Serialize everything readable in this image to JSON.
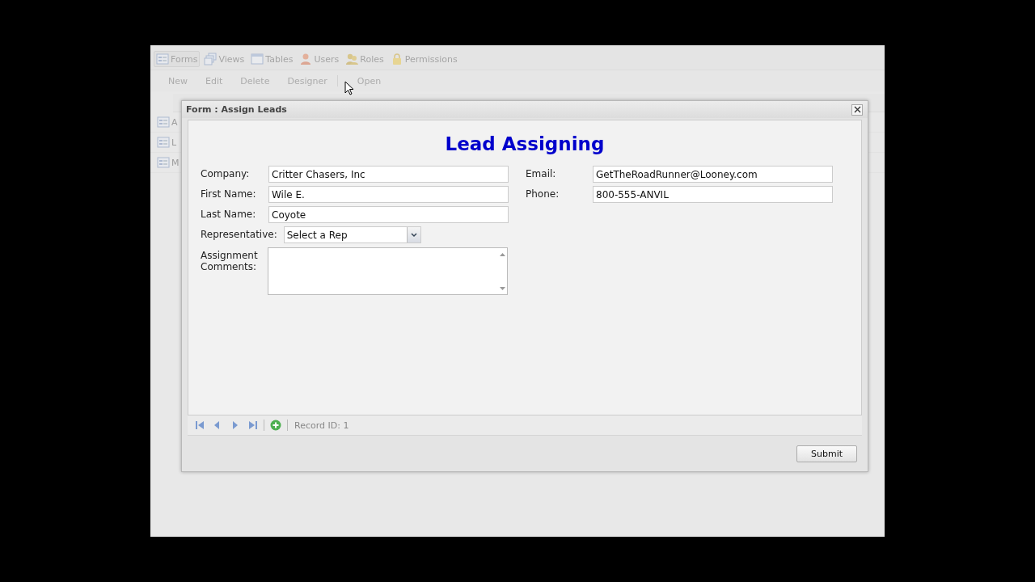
{
  "nav_tabs": [
    {
      "label": "Forms",
      "selected": true
    },
    {
      "label": "Views",
      "selected": false
    },
    {
      "label": "Tables",
      "selected": false
    },
    {
      "label": "Users",
      "selected": false
    },
    {
      "label": "Roles",
      "selected": false
    },
    {
      "label": "Permissions",
      "selected": false
    }
  ],
  "toolbar": [
    {
      "label": "New"
    },
    {
      "label": "Edit"
    },
    {
      "label": "Delete"
    },
    {
      "label": "Designer"
    },
    {
      "label": "Open"
    }
  ],
  "grid": {
    "rows": [
      {
        "name": "A"
      },
      {
        "name": "L"
      },
      {
        "name": "M"
      }
    ]
  },
  "dialog": {
    "title": "Form : Assign Leads",
    "heading": "Lead Assigning",
    "left_fields": [
      {
        "kind": "text",
        "label": "Company:",
        "value": "Critter Chasers, Inc"
      },
      {
        "kind": "text",
        "label": "First Name:",
        "value": "Wile E."
      },
      {
        "kind": "text",
        "label": "Last Name:",
        "value": "Coyote"
      },
      {
        "kind": "select",
        "label": "Representative:",
        "value": "Select a Rep"
      },
      {
        "kind": "textarea",
        "label": "Assignment Comments:"
      }
    ],
    "right_fields": [
      {
        "kind": "text",
        "label": "Email:",
        "value": "GetTheRoadRunner@Looney.com"
      },
      {
        "kind": "text",
        "label": "Phone:",
        "value": "800-555-ANVIL"
      }
    ],
    "record_id": "Record ID: 1",
    "submit": "Submit"
  }
}
